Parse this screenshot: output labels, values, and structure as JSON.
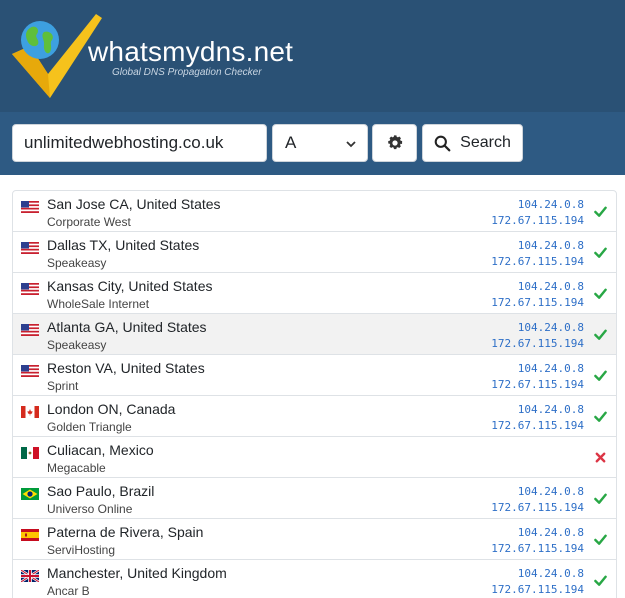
{
  "brand": {
    "name": "whatsmydns.net",
    "tagline": "Global DNS Propagation Checker"
  },
  "search": {
    "domain_value": "unlimitedwebhosting.co.uk",
    "record_type": "A",
    "search_label": "Search"
  },
  "icons": {
    "settings": "gear-icon",
    "search": "search-icon",
    "ok": "check-icon",
    "fail": "cross-icon"
  },
  "colors": {
    "header": "#2a5175",
    "ok": "#28a745",
    "fail": "#dc3545",
    "ip": "#2e6fc7"
  },
  "results": [
    {
      "location": "San Jose CA, United States",
      "provider": "Corporate West",
      "flag": "us",
      "ip1": "104.24.0.8",
      "ip2": "172.67.115.194",
      "status": "ok"
    },
    {
      "location": "Dallas TX, United States",
      "provider": "Speakeasy",
      "flag": "us",
      "ip1": "104.24.0.8",
      "ip2": "172.67.115.194",
      "status": "ok"
    },
    {
      "location": "Kansas City, United States",
      "provider": "WholeSale Internet",
      "flag": "us",
      "ip1": "104.24.0.8",
      "ip2": "172.67.115.194",
      "status": "ok"
    },
    {
      "location": "Atlanta GA, United States",
      "provider": "Speakeasy",
      "flag": "us",
      "ip1": "104.24.0.8",
      "ip2": "172.67.115.194",
      "status": "ok"
    },
    {
      "location": "Reston VA, United States",
      "provider": "Sprint",
      "flag": "us",
      "ip1": "104.24.0.8",
      "ip2": "172.67.115.194",
      "status": "ok"
    },
    {
      "location": "London ON, Canada",
      "provider": "Golden Triangle",
      "flag": "ca",
      "ip1": "104.24.0.8",
      "ip2": "172.67.115.194",
      "status": "ok"
    },
    {
      "location": "Culiacan, Mexico",
      "provider": "Megacable",
      "flag": "mx",
      "ip1": "",
      "ip2": "",
      "status": "fail"
    },
    {
      "location": "Sao Paulo, Brazil",
      "provider": "Universo Online",
      "flag": "br",
      "ip1": "104.24.0.8",
      "ip2": "172.67.115.194",
      "status": "ok"
    },
    {
      "location": "Paterna de Rivera, Spain",
      "provider": "ServiHosting",
      "flag": "es",
      "ip1": "104.24.0.8",
      "ip2": "172.67.115.194",
      "status": "ok"
    },
    {
      "location": "Manchester, United Kingdom",
      "provider": "Ancar B",
      "flag": "gb",
      "ip1": "104.24.0.8",
      "ip2": "172.67.115.194",
      "status": "ok"
    }
  ]
}
